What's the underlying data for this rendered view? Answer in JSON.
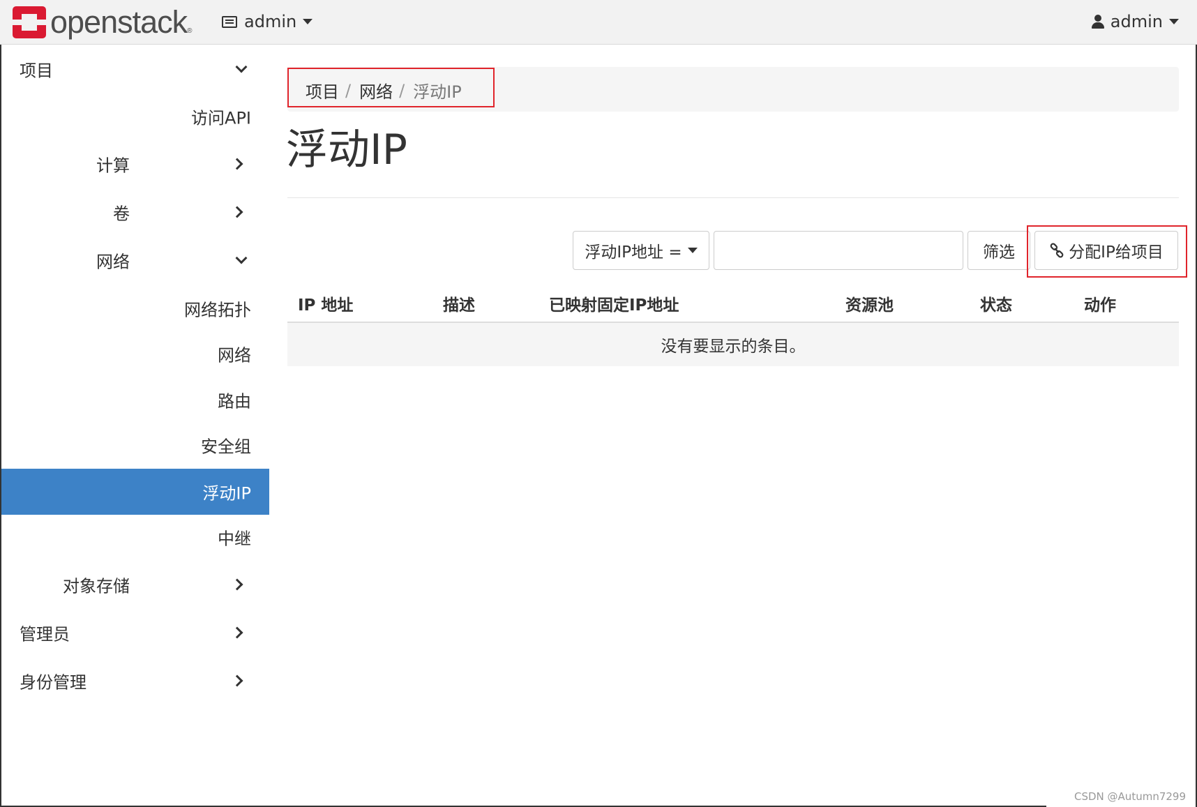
{
  "header": {
    "logo_text": "openstack",
    "logo_reg": "®",
    "project_menu": "admin",
    "user_menu": "admin"
  },
  "sidebar": {
    "project": "项目",
    "access_api": "访问API",
    "compute": "计算",
    "volumes": "卷",
    "network": "网络",
    "network_topology": "网络拓扑",
    "networks": "网络",
    "routers": "路由",
    "security_groups": "安全组",
    "floating_ips": "浮动IP",
    "trunks": "中继",
    "object_store": "对象存储",
    "admin": "管理员",
    "identity": "身份管理"
  },
  "breadcrumb": {
    "items": [
      "项目",
      "网络",
      "浮动IP"
    ],
    "separator": "/"
  },
  "page": {
    "title": "浮动IP"
  },
  "filter": {
    "field_label": "浮动IP地址 =",
    "input_value": "",
    "button_label": "筛选"
  },
  "actions": {
    "allocate_label": "分配IP给项目"
  },
  "table": {
    "columns": [
      "IP 地址",
      "描述",
      "已映射固定IP地址",
      "资源池",
      "状态",
      "动作"
    ],
    "empty_message": "没有要显示的条目。"
  },
  "watermark": "CSDN @Autumn7299",
  "colors": {
    "brand_red": "#da1a32",
    "active_blue": "#3d82c7",
    "highlight_red": "#e0242b"
  }
}
